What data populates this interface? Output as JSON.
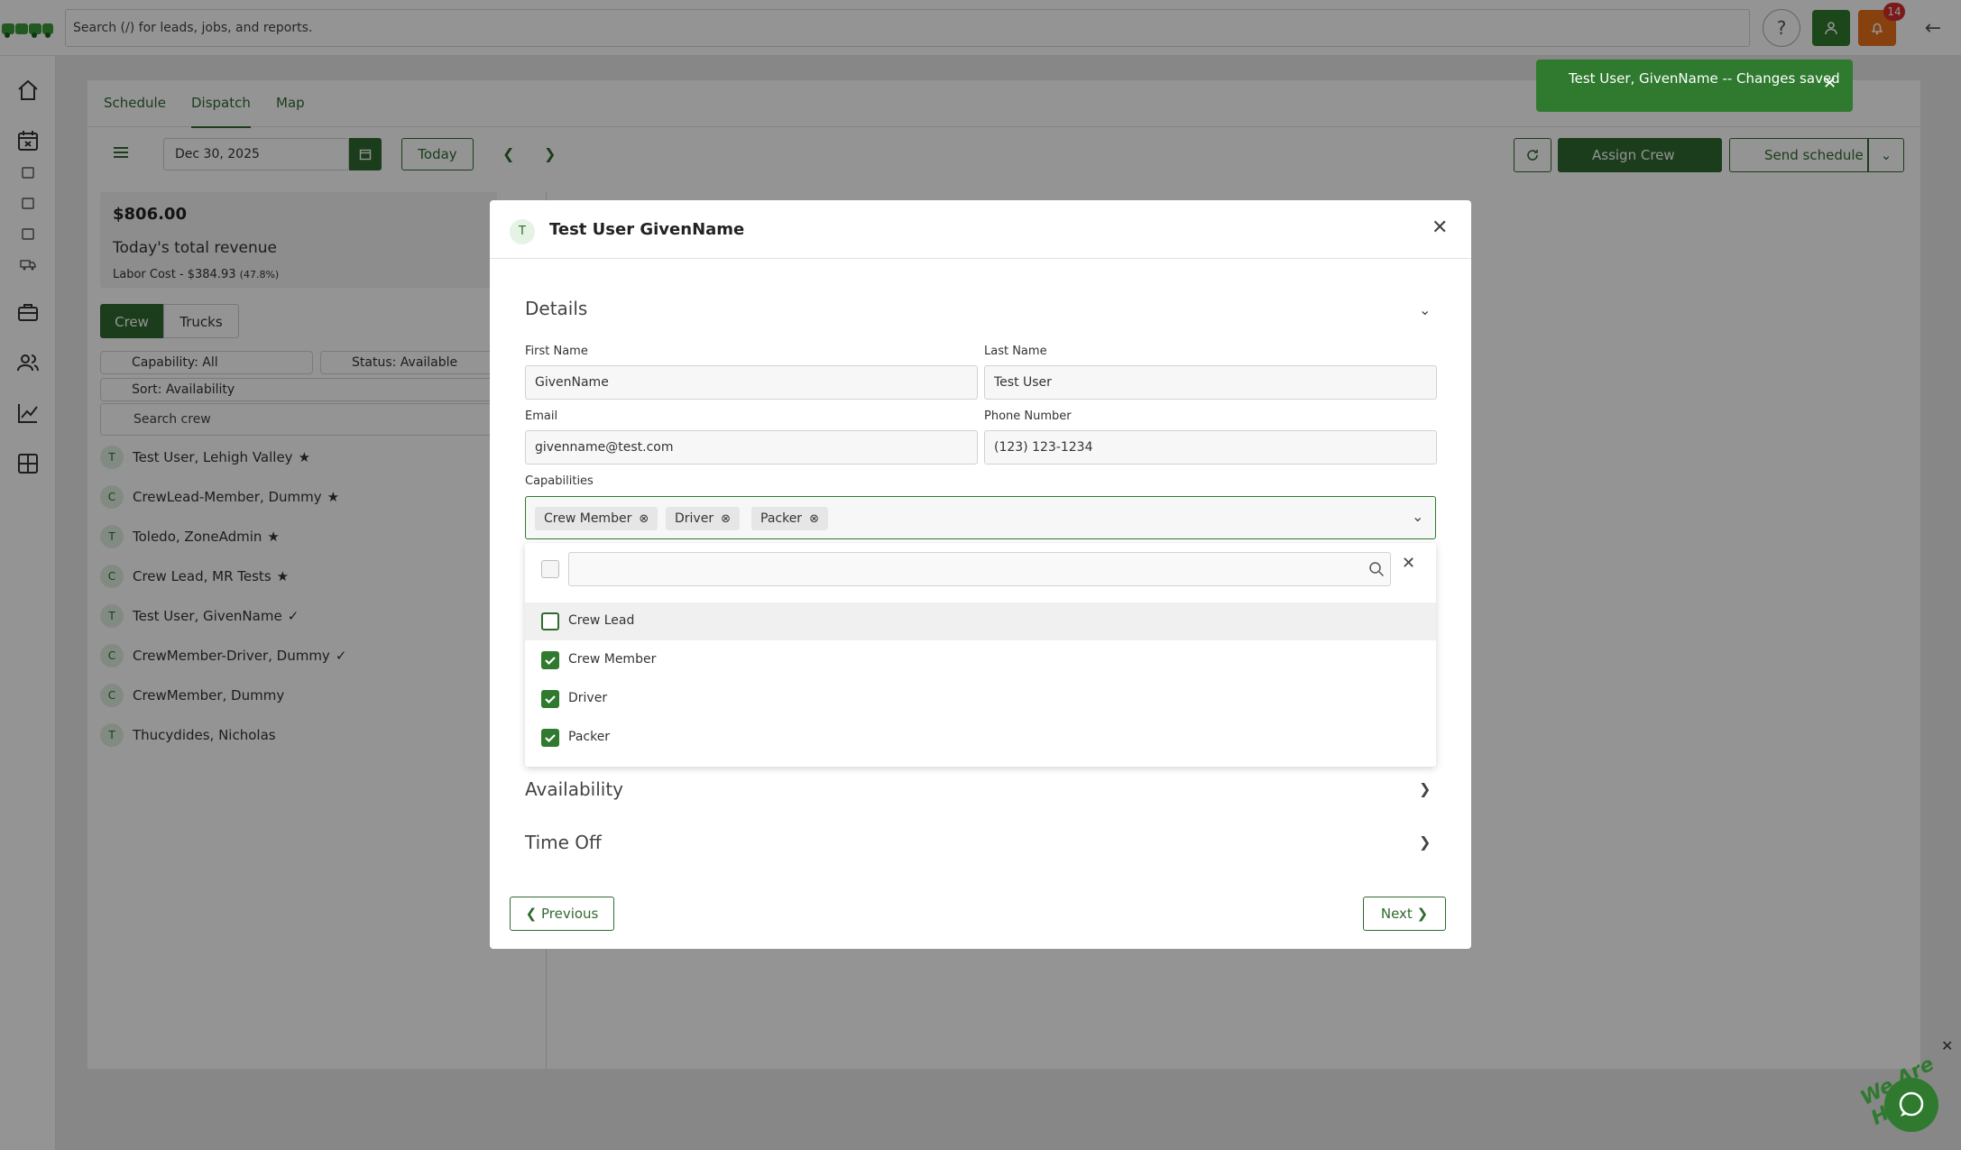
{
  "topbar": {
    "search_placeholder": "Search (/) for leads, jobs, and reports.",
    "notification_count": "14",
    "help_label": "?"
  },
  "tabs": [
    {
      "label": "Schedule"
    },
    {
      "label": "Dispatch"
    },
    {
      "label": "Map"
    }
  ],
  "toolbar": {
    "date": "Dec 30, 2025",
    "today": "Today",
    "assign_crew": "Assign Crew",
    "send_schedule": "Send schedule"
  },
  "revenue": {
    "amount": "$806.00",
    "label": "Today's total revenue",
    "labor": "Labor Cost - $384.93",
    "labor_pct": "(47.8%)"
  },
  "segments": {
    "crew": "Crew",
    "trucks": "Trucks"
  },
  "filters": {
    "capability": "Capability: All",
    "status": "Status: Available",
    "sort": "Sort: Availability",
    "search": "Search crew"
  },
  "crew_list": [
    {
      "initial": "T",
      "name": "Test User, Lehigh Valley"
    },
    {
      "initial": "C",
      "name": "CrewLead-Member, Dummy"
    },
    {
      "initial": "T",
      "name": "Toledo, ZoneAdmin"
    },
    {
      "initial": "C",
      "name": "Crew Lead, MR Tests"
    },
    {
      "initial": "T",
      "name": "Test User, GivenName"
    },
    {
      "initial": "C",
      "name": "CrewMember-Driver, Dummy"
    },
    {
      "initial": "C",
      "name": "CrewMember, Dummy"
    },
    {
      "initial": "T",
      "name": "Thucydides, Nicholas"
    }
  ],
  "toast": {
    "text": "Test User, GivenName -- Changes saved"
  },
  "modal": {
    "avatar": "T",
    "title": "Test User GivenName",
    "details_title": "Details",
    "first_name_label": "First Name",
    "first_name": "GivenName",
    "last_name_label": "Last Name",
    "last_name": "Test User",
    "email_label": "Email",
    "email": "givenname@test.com",
    "phone_label": "Phone Number",
    "phone": "(123) 123-1234",
    "capabilities_label": "Capabilities",
    "chips": [
      "Crew Member",
      "Driver",
      "Packer"
    ],
    "options": [
      {
        "label": "Crew Lead",
        "checked": false
      },
      {
        "label": "Crew Member",
        "checked": true
      },
      {
        "label": "Driver",
        "checked": true
      },
      {
        "label": "Packer",
        "checked": true
      }
    ],
    "availability_title": "Availability",
    "timeoff_title": "Time Off",
    "previous": "Previous",
    "next": "Next"
  },
  "chat": {
    "tag": "We Are Here!"
  }
}
